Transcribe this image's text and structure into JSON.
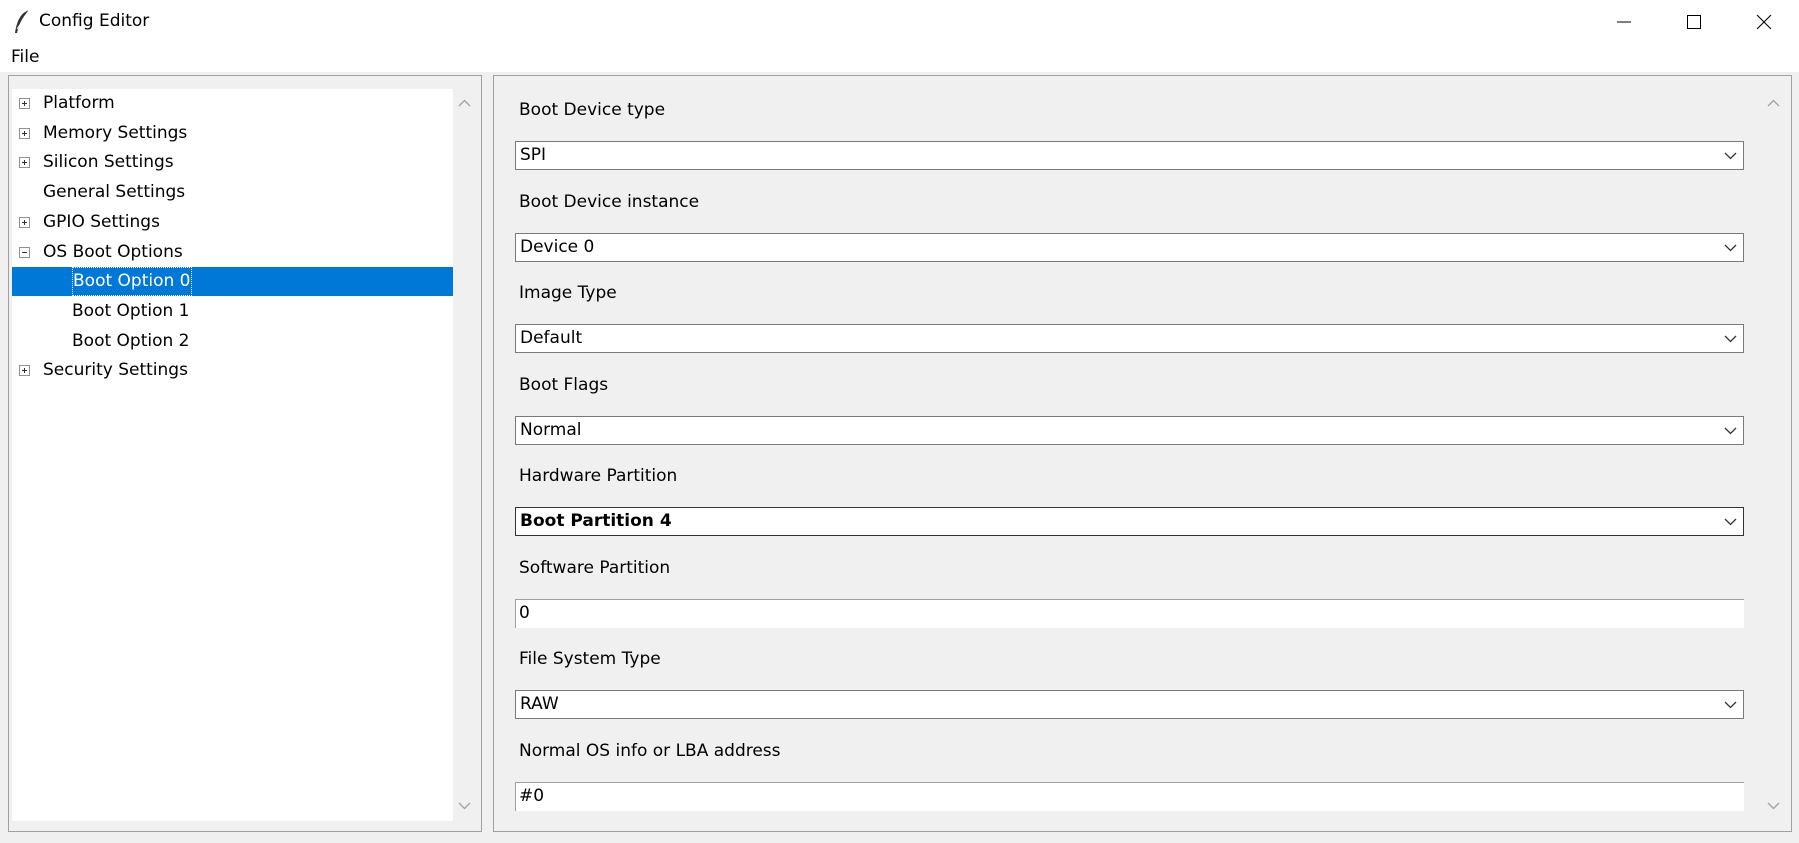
{
  "window": {
    "title": "Config Editor",
    "icons": {
      "app": "feather-icon",
      "minimize": "minimize-icon",
      "maximize": "maximize-icon",
      "close": "close-icon"
    }
  },
  "menu": {
    "file": "File"
  },
  "tree": {
    "items": [
      {
        "label": "Platform",
        "expander": "plus",
        "level": 0
      },
      {
        "label": "Memory Settings",
        "expander": "plus",
        "level": 0
      },
      {
        "label": "Silicon Settings",
        "expander": "plus",
        "level": 0
      },
      {
        "label": "General Settings",
        "expander": "none",
        "level": 0
      },
      {
        "label": "GPIO Settings",
        "expander": "plus",
        "level": 0
      },
      {
        "label": "OS Boot Options",
        "expander": "minus",
        "level": 0
      },
      {
        "label": "Boot Option 0",
        "expander": "none",
        "level": 1,
        "selected": true
      },
      {
        "label": "Boot Option 1",
        "expander": "none",
        "level": 1
      },
      {
        "label": "Boot Option 2",
        "expander": "none",
        "level": 1
      },
      {
        "label": "Security Settings",
        "expander": "plus",
        "level": 0
      }
    ],
    "selection_color": "#0078d7"
  },
  "form": {
    "fields": [
      {
        "label": "Boot Device type",
        "kind": "combo",
        "value": "SPI"
      },
      {
        "label": "Boot Device instance",
        "kind": "combo",
        "value": "Device 0"
      },
      {
        "label": "Image Type",
        "kind": "combo",
        "value": "Default"
      },
      {
        "label": "Boot Flags",
        "kind": "combo",
        "value": "Normal"
      },
      {
        "label": "Hardware Partition",
        "kind": "combo",
        "value": "Boot Partition 4",
        "focused": true
      },
      {
        "label": "Software Partition",
        "kind": "entry",
        "value": "0"
      },
      {
        "label": "File System Type",
        "kind": "combo",
        "value": "RAW"
      },
      {
        "label": "Normal OS info or LBA address",
        "kind": "entry",
        "value": "#0"
      }
    ]
  }
}
